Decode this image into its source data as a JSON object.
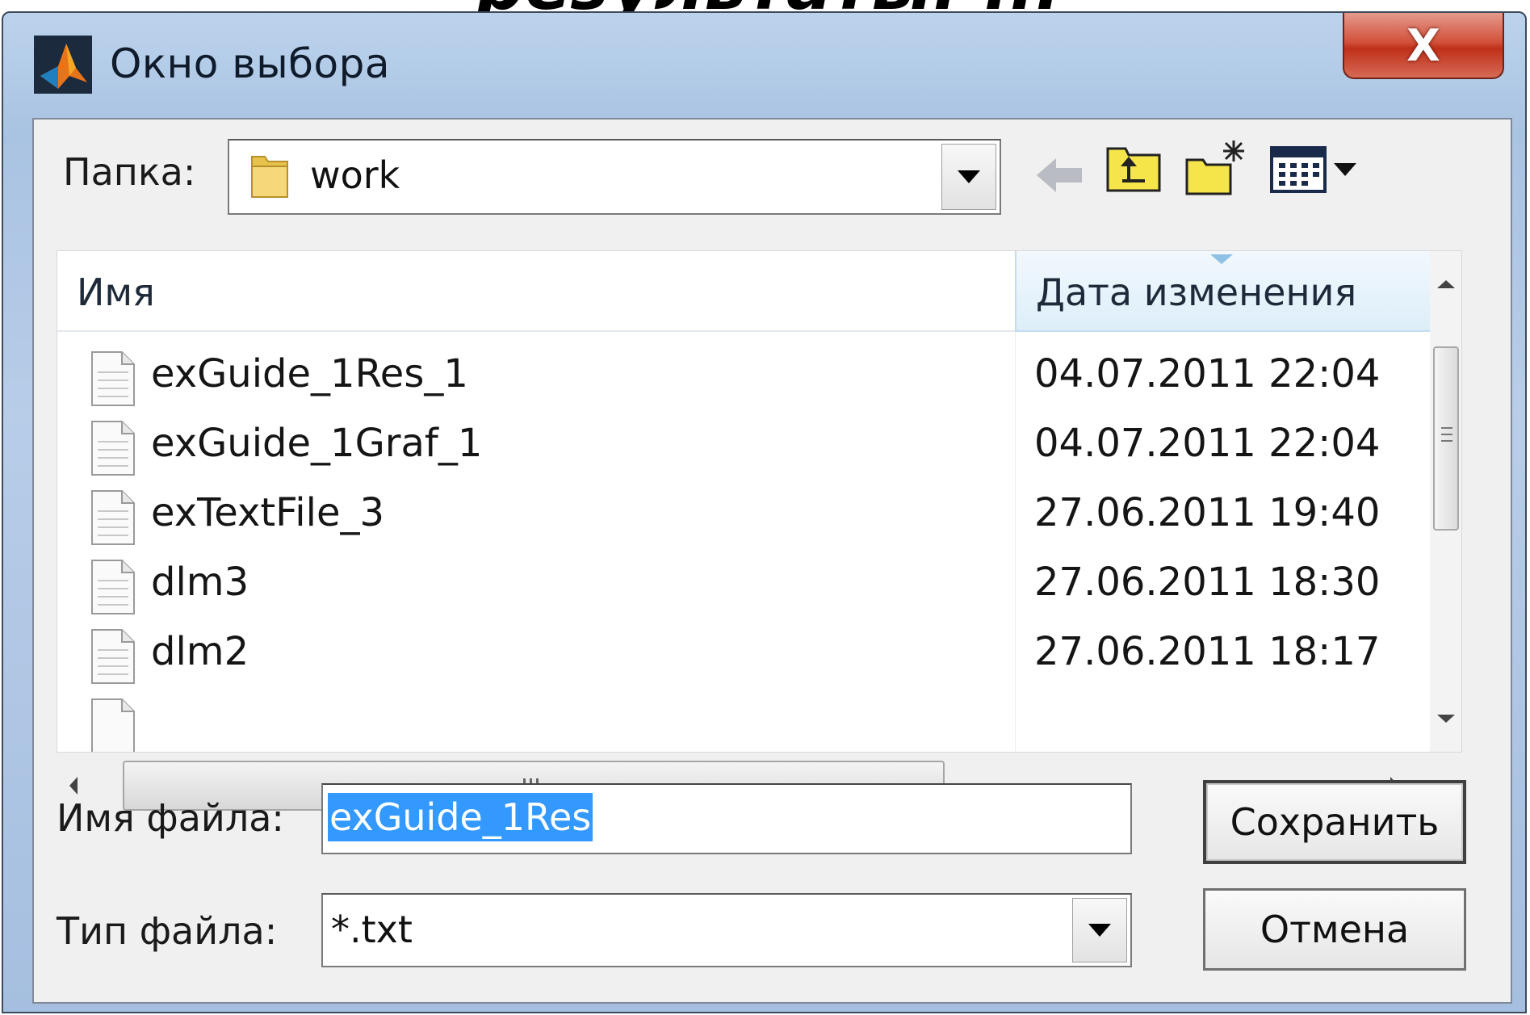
{
  "slide": {
    "title_fragment": "результаты: ..."
  },
  "window": {
    "title": "Окно выбора",
    "close_label": "X"
  },
  "folder": {
    "label": "Папка:",
    "current": "work"
  },
  "toolbar": {
    "icons": [
      "back-arrow-icon",
      "up-folder-icon",
      "new-folder-icon",
      "view-menu-icon"
    ]
  },
  "list": {
    "columns": {
      "name": "Имя",
      "date": "Дата изменения"
    },
    "rows": [
      {
        "name": "exGuide_1Res_1",
        "date": "04.07.2011 22:04"
      },
      {
        "name": "exGuide_1Graf_1",
        "date": "04.07.2011 22:04"
      },
      {
        "name": "exTextFile_3",
        "date": "27.06.2011 19:40"
      },
      {
        "name": "dlm3",
        "date": "27.06.2011 18:30"
      },
      {
        "name": "dlm2",
        "date": "27.06.2011 18:17"
      }
    ]
  },
  "filename": {
    "label": "Имя файла:",
    "value": "exGuide_1Res"
  },
  "filetype": {
    "label": "Тип файла:",
    "value": "*.txt"
  },
  "buttons": {
    "save": "Сохранить",
    "cancel": "Отмена"
  },
  "colors": {
    "selection": "#3399ff",
    "close_button": "#c8402a",
    "header_highlight": "#ddeef9"
  }
}
